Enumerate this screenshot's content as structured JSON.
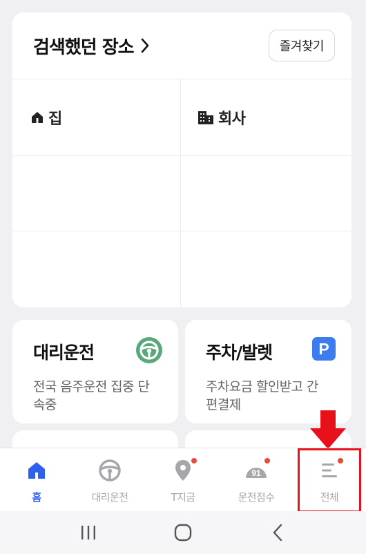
{
  "places": {
    "title": "검색했던 장소",
    "favorites_button": "즐겨찾기",
    "cells": [
      {
        "label": "집",
        "icon": "home-icon"
      },
      {
        "label": "회사",
        "icon": "building-icon"
      },
      {
        "label": ""
      },
      {
        "label": ""
      },
      {
        "label": ""
      },
      {
        "label": ""
      }
    ]
  },
  "services": [
    {
      "title": "대리운전",
      "desc": "전국 음주운전 집중 단속중",
      "icon": "steering-wheel-icon",
      "icon_color": "#58a97a"
    },
    {
      "title": "주차/발렛",
      "desc": "주차요금 할인받고 간편결제",
      "icon": "parking-icon",
      "icon_color": "#3d7bf0",
      "icon_text": "P"
    }
  ],
  "bottom_nav": {
    "items": [
      {
        "label": "홈",
        "icon": "home-icon",
        "active": true
      },
      {
        "label": "대리운전",
        "icon": "steering-wheel-icon"
      },
      {
        "label": "T지금",
        "icon": "map-pin-icon",
        "badge": true
      },
      {
        "label": "운전점수",
        "icon": "gauge-icon",
        "badge": true,
        "icon_text": "91"
      },
      {
        "label": "전체",
        "icon": "menu-icon",
        "badge": true
      }
    ]
  },
  "colors": {
    "accent": "#2e60f0",
    "badge": "#e84a3b",
    "highlight": "#e8101b"
  }
}
